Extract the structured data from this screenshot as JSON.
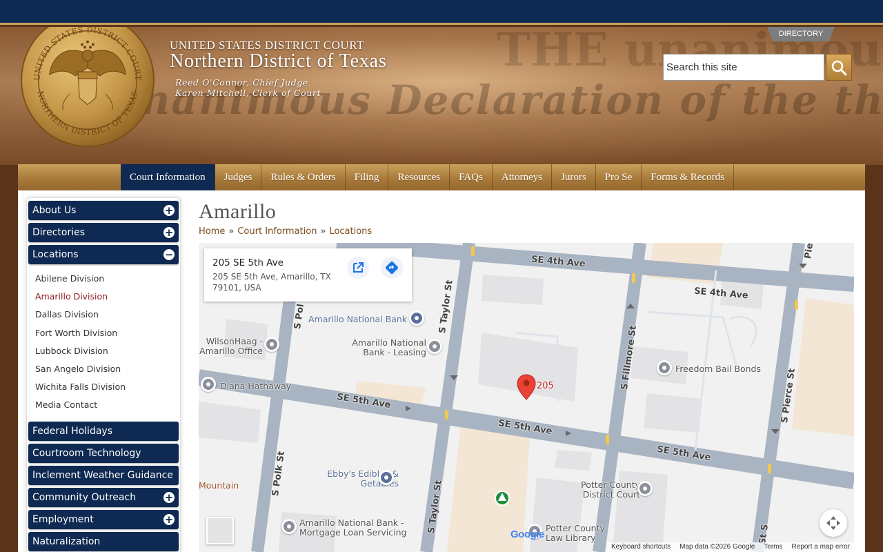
{
  "header": {
    "directory_label": "DIRECTORY",
    "court_top": "UNITED STATES DISTRICT COURT",
    "court_name": "Northern District of Texas",
    "chief_judge": "Reed O'Connor, Chief Judge",
    "clerk": "Karen Mitchell, Clerk of Court",
    "search_placeholder": "Search this site",
    "seal_text_top": "UNITED STATES DISTRICT COURT",
    "seal_text_bottom": "NORTHERN DISTRICT OF TEXAS"
  },
  "nav": {
    "items": [
      {
        "label": "Court Information",
        "active": true
      },
      {
        "label": "Judges"
      },
      {
        "label": "Rules & Orders"
      },
      {
        "label": "Filing"
      },
      {
        "label": "Resources"
      },
      {
        "label": "FAQs"
      },
      {
        "label": "Attorneys"
      },
      {
        "label": "Jurors"
      },
      {
        "label": "Pro Se"
      },
      {
        "label": "Forms & Records"
      }
    ]
  },
  "sidebar": {
    "items": [
      {
        "label": "About Us",
        "toggle": "+"
      },
      {
        "label": "Directories",
        "toggle": "+"
      },
      {
        "label": "Locations",
        "toggle": "−"
      },
      {
        "label": "Federal Holidays"
      },
      {
        "label": "Courtroom Technology"
      },
      {
        "label": "Inclement Weather Guidance"
      },
      {
        "label": "Community Outreach",
        "toggle": "+"
      },
      {
        "label": "Employment",
        "toggle": "+"
      },
      {
        "label": "Naturalization"
      }
    ],
    "locations": [
      "Abilene Division",
      "Amarillo Division",
      "Dallas Division",
      "Fort Worth Division",
      "Lubbock Division",
      "San Angelo Division",
      "Wichita Falls Division",
      "Media Contact"
    ],
    "current_location": "Amarillo Division"
  },
  "main": {
    "title": "Amarillo",
    "breadcrumb": [
      "Home",
      "Court Information",
      "Locations"
    ],
    "breadcrumb_sep": "»"
  },
  "map": {
    "card_title": "205 SE 5th Ave",
    "card_address": "205 SE 5th Ave, Amarillo, TX 79101, USA",
    "marker_label": "205",
    "streets": [
      "SE 4th Ave",
      "SE 4th Ave",
      "SE 5th Ave",
      "SE 5th Ave",
      "SE 5th Ave",
      "S Taylor St",
      "S Taylor St",
      "S Fillmore St",
      "S Pierce St",
      "S Polk St",
      "S Pol",
      "St S",
      "Pie"
    ],
    "pois": [
      "Amarillo National Bank",
      "Amarillo National Bank - Leasing",
      "WilsonHaag - Amarillo Office",
      "Diana Hathaway",
      "Freedom Bail Bonds",
      "Ebby's Edibles & Getables",
      "Potter County District Court",
      "Amarillo National Bank - Mortgage Loan Servicing",
      "Potter County Law Library",
      "Mountain"
    ],
    "google": "Google",
    "attribution": [
      "Keyboard shortcuts",
      "Map data ©2026 Google",
      "Terms",
      "Report a map error"
    ]
  }
}
